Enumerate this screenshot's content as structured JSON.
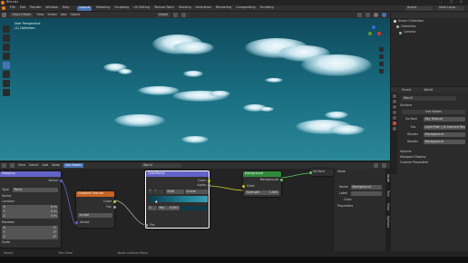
{
  "titlebar": {
    "title": "Blender",
    "controls": [
      "minimize",
      "maximize",
      "close"
    ]
  },
  "menubar": {
    "items": [
      "File",
      "Edit",
      "Render",
      "Window",
      "Help"
    ],
    "workspaces": [
      "Layout",
      "Modeling",
      "Sculpting",
      "UV Editing",
      "Texture Paint",
      "Shading",
      "Animation",
      "Rendering",
      "Compositing",
      "Scripting"
    ],
    "scene": "Scene",
    "view_layer": "View Layer"
  },
  "viewport": {
    "mode": "Object Mode",
    "menus": [
      "View",
      "Select",
      "Add",
      "Object"
    ],
    "orientation": "Global",
    "overlay_title": "User Perspective",
    "overlay_sub": "(1) Collection"
  },
  "outliner": {
    "header": "Scene Collection",
    "items": [
      "Collection",
      "Camera"
    ]
  },
  "properties": {
    "tabs": [
      "Scene",
      "World"
    ],
    "world_name": "World",
    "panel_surface": "Surface",
    "use_nodes": "Use Nodes",
    "surface_label": "Surface",
    "surface_value": "Sky Texture",
    "mix_label": "Fac",
    "mix_value": "Light Path | Is Camera Ray",
    "shader1_label": "Shader",
    "shader1_value": "Background",
    "shader2_label": "Shader",
    "shader2_value": "Background",
    "panels": [
      "Volume",
      "Viewport Display",
      "Custom Properties"
    ]
  },
  "node_editor": {
    "header_menus": [
      "View",
      "Select",
      "Add",
      "Node"
    ],
    "use_nodes": "Use Nodes",
    "world_name": "World",
    "slot": "Slot",
    "sidebar_tabs": [
      "Node",
      "Tool",
      "View",
      "Options"
    ],
    "sidebar": {
      "section": "Node",
      "name_label": "Name",
      "name_value": "Background",
      "label_label": "Label",
      "color_label": "Color",
      "properties": "Properties"
    }
  },
  "nodes": {
    "mapping": {
      "title": "Mapping",
      "out": "Vector",
      "type_label": "Type",
      "type_value": "Point",
      "vector": "Vector",
      "location": "Location",
      "loc": [
        {
          "a": "X",
          "v": "0 m"
        },
        {
          "a": "Y",
          "v": "0 m"
        },
        {
          "a": "Z",
          "v": "0 m"
        }
      ],
      "rotation": "Rotation",
      "rot": [
        {
          "a": "X",
          "v": "0°"
        },
        {
          "a": "Y",
          "v": "0°"
        },
        {
          "a": "Z",
          "v": "0°"
        }
      ],
      "scale": "Scale"
    },
    "gradient": {
      "title": "Gradient Texture",
      "out1": "Color",
      "out2": "Fac",
      "mode": "Linear",
      "in": "Vector"
    },
    "colorramp": {
      "title": "ColorRamp",
      "out1": "Color",
      "out2": "Alpha",
      "interp": "RGB",
      "mode": "Linear",
      "pos_label": "Pos",
      "pos_value": "0.000",
      "index": "0",
      "in": "Fac"
    },
    "background": {
      "title": "Background",
      "out": "Background",
      "in_color": "Color",
      "in_strength": "Strength",
      "strength": "1.000"
    },
    "world_output": {
      "title": "World Output",
      "in1": "Surface",
      "in2": "Volume",
      "target": "All"
    }
  },
  "statusbar": {
    "left": "Select",
    "mid": "Pan View",
    "right": "Node Context Menu"
  }
}
